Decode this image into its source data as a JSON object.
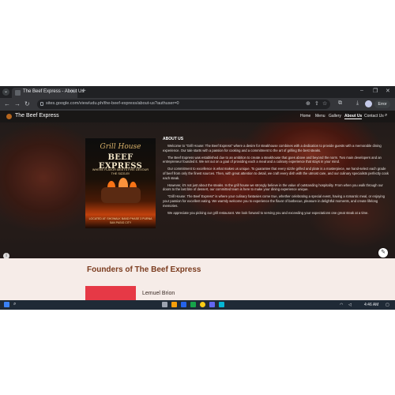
{
  "browser": {
    "tab_title": "The Beef Express - About Us",
    "url": "sites.google.com/view/udu.ph/the-beef-express/about-us?authuser=0",
    "profile_label": "Error",
    "window_controls": [
      "–",
      "❐",
      "✕"
    ]
  },
  "site": {
    "title": "The Beef Express",
    "nav": [
      "Home",
      "Menu",
      "Gallery",
      "About Us",
      "Contact Us"
    ],
    "active_nav": "About Us"
  },
  "poster": {
    "script": "Grill House",
    "brand": "BEEF EXPRESS",
    "tagline": "WHERE FLAVOR MEETS FIRE DEVOUR THE SIZZLE!!",
    "address": "LOCATED AT: SHOWALK BAND PHASE 3 PURNA SAN PASIG CITY"
  },
  "about": {
    "heading": "ABOUT US",
    "paragraphs": [
      "Welcome to \"Grill House: The Beef Express\" where a desire for steakhouse combines with a dedication to provide guests with a memorable dining experience. Our tale starts with a passion for cooking and a commitment to the art of grilling the best steaks.",
      "The Beef Express was established due to an ambition to create a steakhouse that goes above and beyond the norm. Two main developers and an entrepreneur founded it. We set out on a goal of providing each a meal and a culinary experience that stays in your mind.",
      "Our commitment to excellence is what makes us unique. To guarantee that every sizzle grilled and plate is a masterpiece, we hand-select each grade of beef from only the finest sources. Then, with great attention to detail, we craft every dish with the utmost care, and our culinary specialists perfectly cook each steak.",
      "However, it's not just about the steaks. In the grill house we strongly believe in the value of outstanding hospitality. From when you walk through our doors to the last bite of dessert, our committed team is here to make your dining experience unique.",
      "\"Grill House: The Beef Express\" is where your culinary fantasies come true, whether celebrating a special event, having a romantic meal, or enjoying your passion for excellent eating. We warmly welcome you to experience the flavor of barbecue, pleasure in delightful moments, and create lifelong memories.",
      "We appreciate you picking our grill restaurant. We look forward to serving you and exceeding your expectations one great steak at a time."
    ]
  },
  "founders": {
    "title": "Founders of The Beef Express",
    "first_name": "Lemuel Brion"
  },
  "taskbar": {
    "time": "4:46 AM"
  }
}
